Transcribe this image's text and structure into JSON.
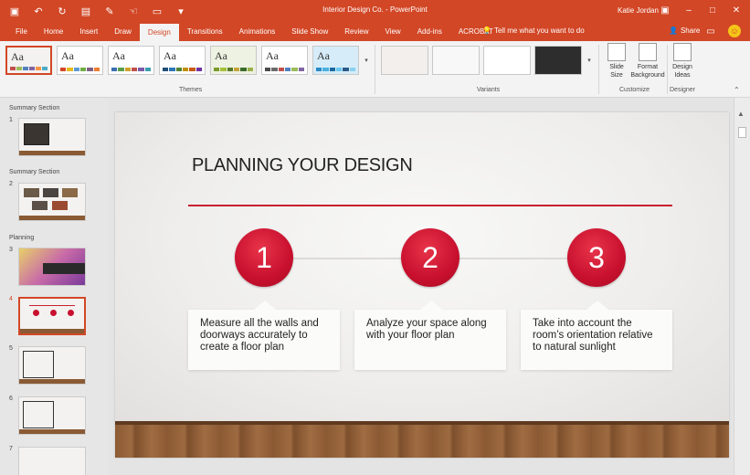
{
  "window": {
    "title": "Interior Design Co.  -  PowerPoint",
    "user": "Katie Jordan"
  },
  "tabs": [
    "File",
    "Home",
    "Insert",
    "Draw",
    "Design",
    "Transitions",
    "Animations",
    "Slide Show",
    "Review",
    "View",
    "Add-ins",
    "ACROBAT"
  ],
  "active_tab": "Design",
  "tell_me": "Tell me what you want to do",
  "share_label": "Share",
  "ribbon": {
    "themes_label": "Themes",
    "variants_label": "Variants",
    "customize_label": "Customize",
    "designer_label": "Designer",
    "theme_aa": [
      "Aa",
      "Aa",
      "Aa",
      "Aa",
      "Aa",
      "Aa",
      "Aa"
    ],
    "slide_size": "Slide Size",
    "format_background": "Format Background",
    "design_ideas": "Design Ideas"
  },
  "colors": {
    "accent": "#d24726",
    "slide_red": "#c8202f"
  },
  "thumbnails": {
    "sections": [
      "Summary Section",
      "Summary Section",
      "Planning"
    ],
    "numbers": [
      "1",
      "2",
      "3",
      "4",
      "5",
      "6",
      "7"
    ],
    "current": "4"
  },
  "slide": {
    "title": "PLANNING YOUR DESIGN",
    "steps": [
      {
        "num": "1",
        "text": "Measure all the walls and doorways accurately to create a floor plan"
      },
      {
        "num": "2",
        "text": "Analyze your space along with your floor plan"
      },
      {
        "num": "3",
        "text": "Take into account the room’s orientation relative to natural sunlight"
      }
    ]
  }
}
